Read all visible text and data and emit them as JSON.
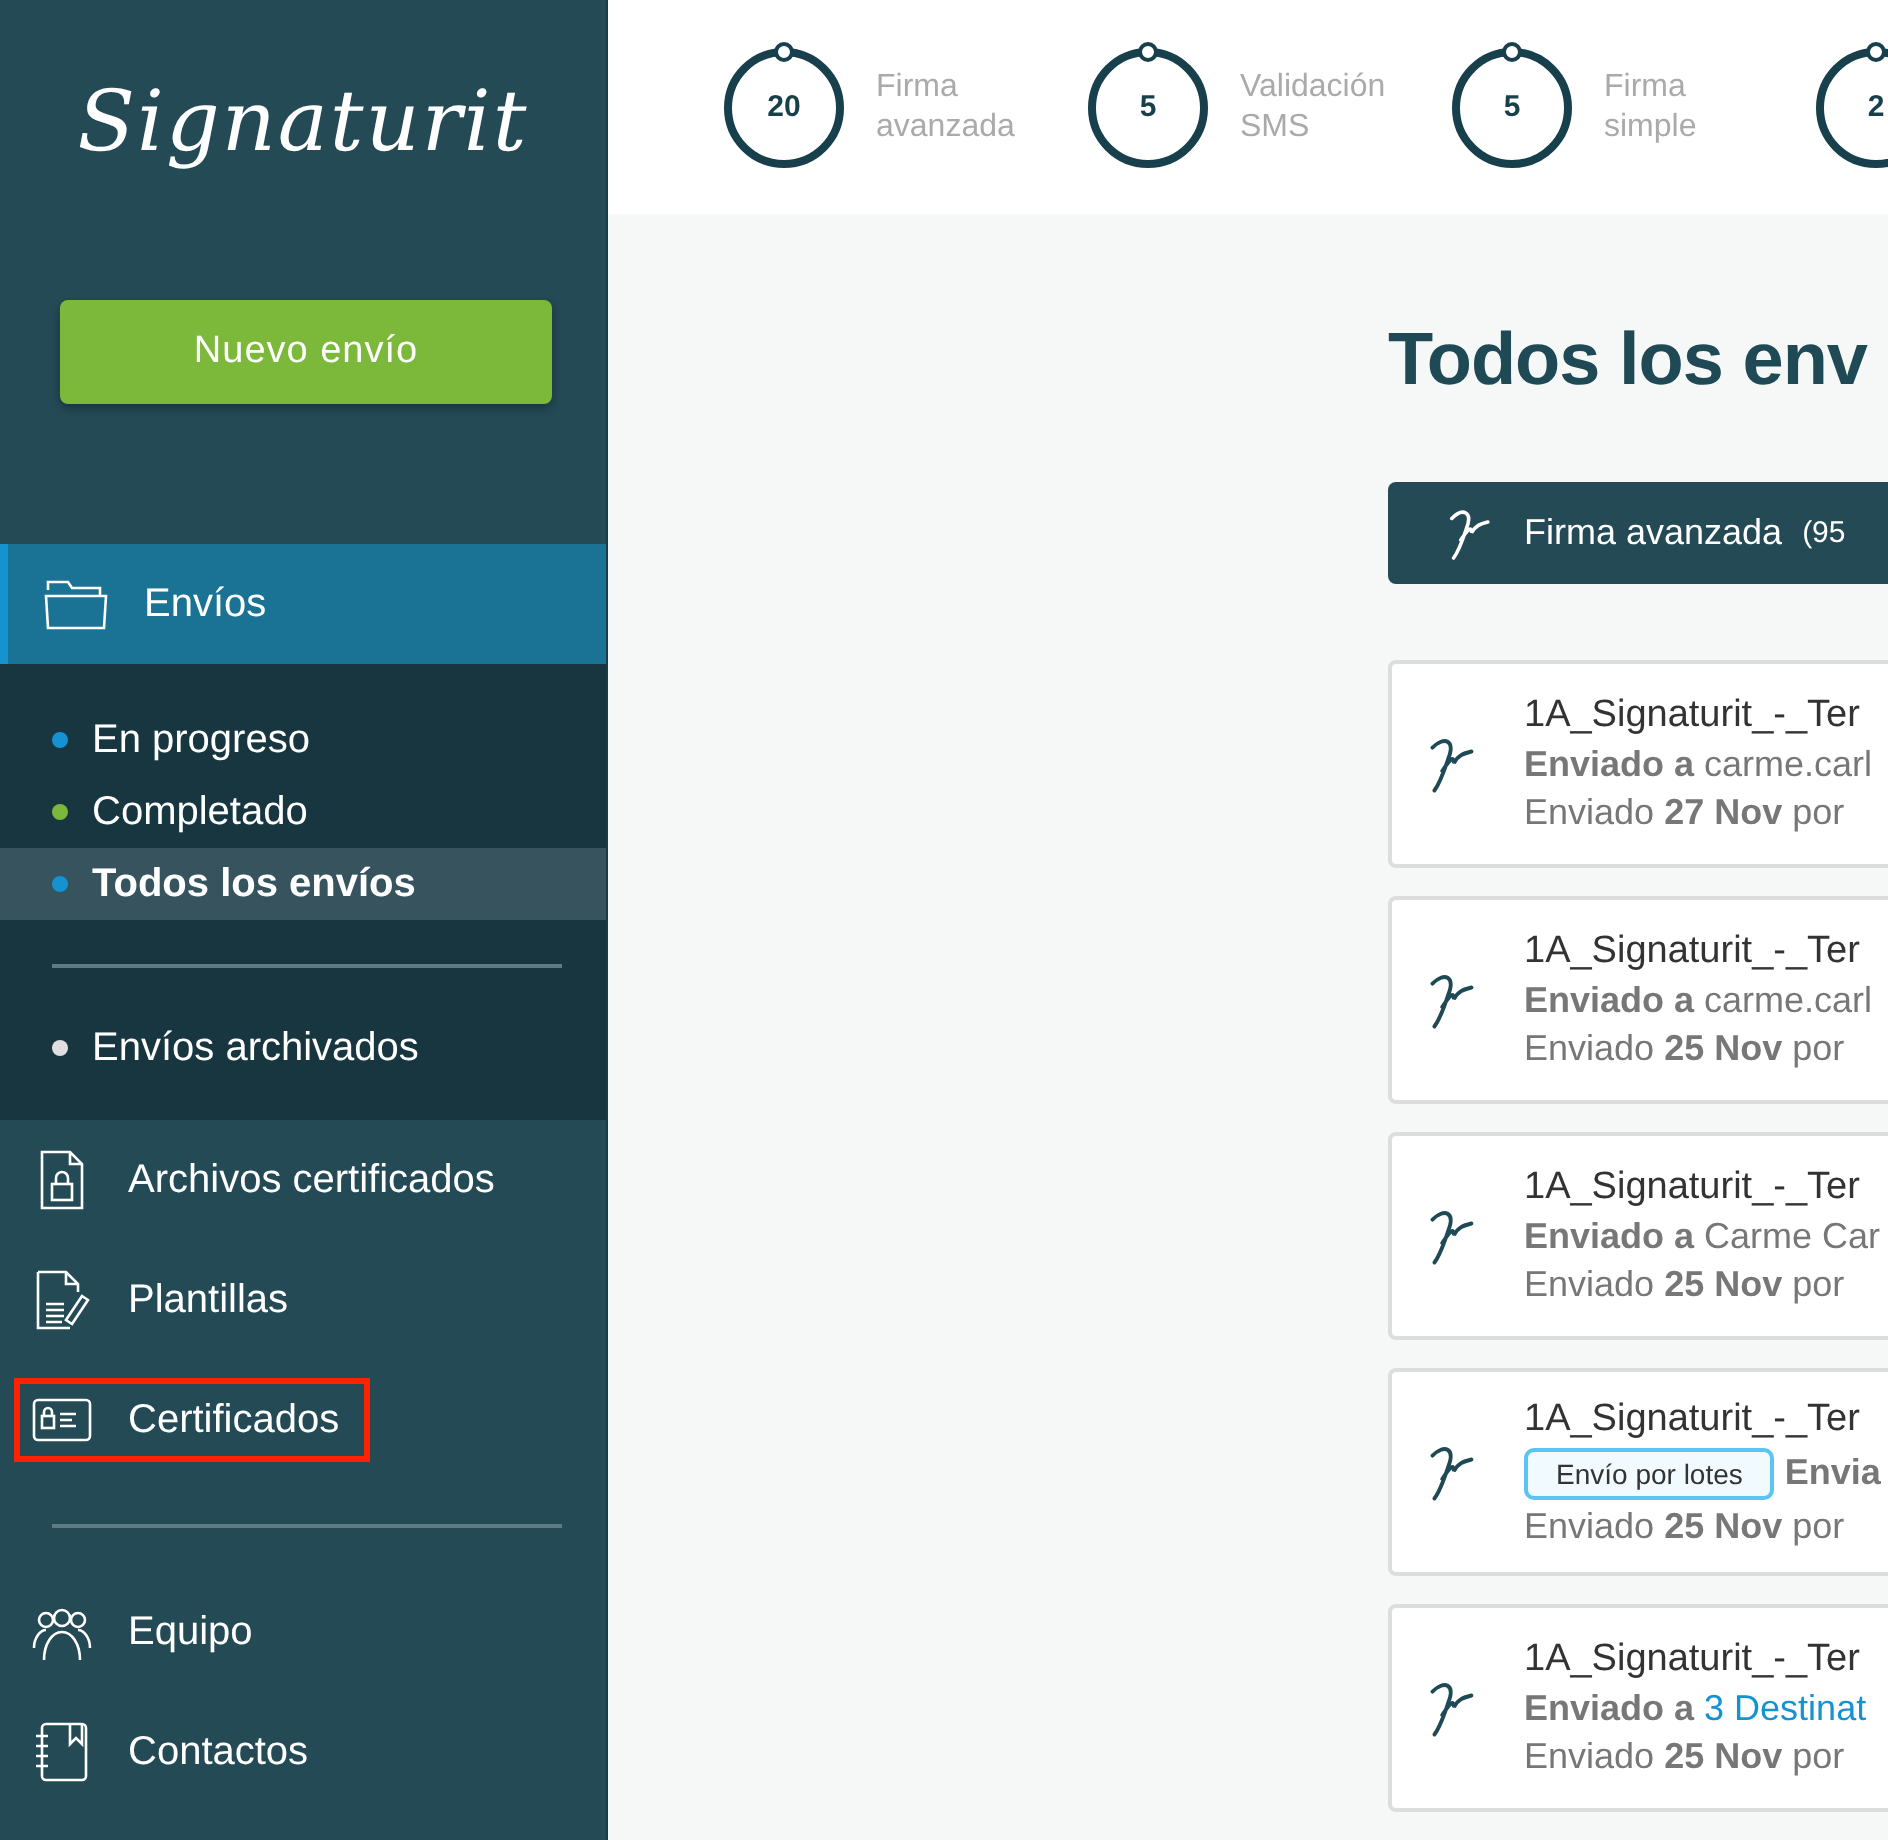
{
  "sidebar": {
    "logo": "Signaturit",
    "new_button": "Nuevo envío",
    "section": {
      "label": "Envíos",
      "selected": true,
      "expanded": true,
      "items": [
        {
          "label": "En progreso",
          "color": "#1592d0",
          "selected": false
        },
        {
          "label": "Completado",
          "color": "#7cb83a",
          "selected": false
        },
        {
          "label": "Todos los envíos",
          "color": "#1592d0",
          "selected": true
        }
      ],
      "archived": {
        "label": "Envíos archivados",
        "color": "#e0e0e0",
        "selected": false
      }
    },
    "nav": [
      {
        "label": "Archivos certificados",
        "kind": "locked-file",
        "highlighted": false
      },
      {
        "label": "Plantillas",
        "kind": "template",
        "highlighted": false
      },
      {
        "label": "Certificados",
        "kind": "certificate",
        "highlighted": true
      }
    ],
    "nav_bottom": [
      {
        "label": "Equipo",
        "kind": "team",
        "highlighted": false
      },
      {
        "label": "Contactos",
        "kind": "contacts",
        "highlighted": false
      }
    ]
  },
  "counters": [
    {
      "value": "20",
      "label": "Firma avanzada"
    },
    {
      "value": "5",
      "label": "Validación SMS"
    },
    {
      "value": "5",
      "label": "Firma simple"
    },
    {
      "value": "2"
    }
  ],
  "title": "Todos los env",
  "tab": {
    "label": "Firma avanzada",
    "count": "(95",
    "selected": true
  },
  "cards": [
    {
      "title": "1A_Signaturit_-_Ter",
      "sent_to": "Enviado a",
      "recipient": "carme.carl",
      "recipient_link": false,
      "date_line": "Enviado **27 Nov** por"
    },
    {
      "title": "1A_Signaturit_-_Ter",
      "sent_to": "Enviado a",
      "recipient": "carme.carl",
      "recipient_link": false,
      "date_line": "Enviado **25 Nov** por"
    },
    {
      "title": "1A_Signaturit_-_Ter",
      "sent_to": "Enviado a",
      "recipient": "Carme Car",
      "recipient_link": false,
      "date_line": "Enviado **25 Nov** por"
    },
    {
      "title": "1A_Signaturit_-_Ter",
      "badge": "Envío por lotes",
      "sent_to": "Envia",
      "date_line": "Enviado **25 Nov** por"
    },
    {
      "title": "1A_Signaturit_-_Ter",
      "sent_to": "Enviado a",
      "recipient": "3 Destinat",
      "recipient_link": true,
      "date_line": "Enviado **25 Nov** por"
    }
  ]
}
